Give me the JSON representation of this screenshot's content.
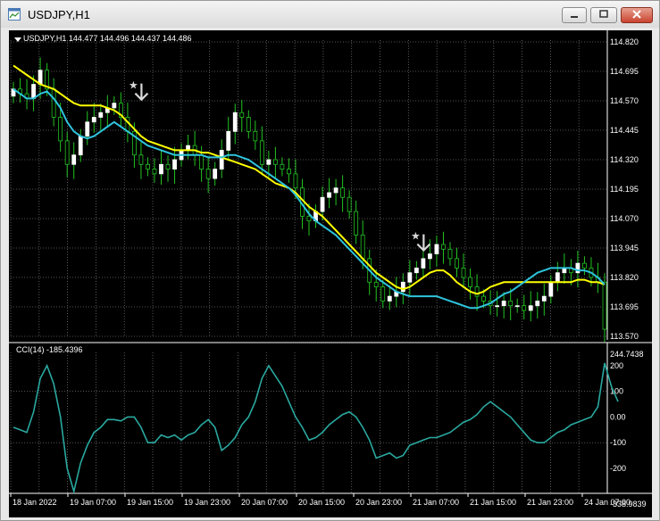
{
  "window": {
    "title": "USDJPY,H1",
    "icon": "chart-window-icon"
  },
  "chart": {
    "symbol_line": "USDJPY,H1  144.477 144.496 144.437 144.486",
    "cci_line": "CCI(14) -185.4396",
    "background": "#000000",
    "grid_color": "#6e6e6e",
    "bull_color": "#ffffff",
    "bear_color": "#000000",
    "wick_color": "#22c422",
    "ma_fast_color": "#2ec4dc",
    "ma_slow_color": "#ffff00",
    "cci_color": "#2aa9a0",
    "text_color": "#ffffff"
  },
  "chart_data": [
    {
      "type": "candlestick",
      "title": "USDJPY,H1",
      "ylim": [
        113.57,
        114.82
      ],
      "price_ticks": [
        "114.820",
        "114.695",
        "114.570",
        "114.445",
        "114.320",
        "114.195",
        "114.070",
        "113.945",
        "113.820",
        "113.695",
        "113.570"
      ],
      "time_labels": [
        "18 Jan 2022",
        "19 Jan 07:00",
        "19 Jan 15:00",
        "19 Jan 23:00",
        "20 Jan 07:00",
        "20 Jan 15:00",
        "20 Jan 23:00",
        "21 Jan 07:00",
        "21 Jan 15:00",
        "21 Jan 23:00",
        "24 Jan 07:00"
      ],
      "close": [
        114.62,
        114.6,
        114.58,
        114.64,
        114.7,
        114.62,
        114.5,
        114.4,
        114.3,
        114.34,
        114.42,
        114.48,
        114.5,
        114.52,
        114.54,
        114.56,
        114.5,
        114.44,
        114.34,
        114.3,
        114.28,
        114.26,
        114.3,
        114.28,
        114.32,
        114.36,
        114.38,
        114.34,
        114.28,
        114.24,
        114.28,
        114.36,
        114.44,
        114.52,
        114.5,
        114.44,
        114.4,
        114.3,
        114.32,
        114.3,
        114.28,
        114.26,
        114.2,
        114.08,
        114.06,
        114.1,
        114.16,
        114.18,
        114.2,
        114.16,
        114.1,
        114.0,
        113.9,
        113.8,
        113.78,
        113.72,
        113.74,
        113.76,
        113.8,
        113.84,
        113.86,
        113.9,
        113.92,
        113.96,
        113.94,
        113.9,
        113.86,
        113.82,
        113.78,
        113.74,
        113.72,
        113.7,
        113.7,
        113.72,
        113.7,
        113.7,
        113.68,
        113.7,
        113.72,
        113.74,
        113.8,
        113.84,
        113.86,
        113.84,
        113.88,
        113.86,
        113.82,
        113.8,
        113.6
      ],
      "ma_slow": [
        114.72,
        114.7,
        114.68,
        114.66,
        114.64,
        114.63,
        114.62,
        114.6,
        114.58,
        114.56,
        114.55,
        114.55,
        114.55,
        114.55,
        114.54,
        114.53,
        114.51,
        114.48,
        114.45,
        114.42,
        114.4,
        114.39,
        114.38,
        114.37,
        114.36,
        114.36,
        114.36,
        114.36,
        114.35,
        114.35,
        114.34,
        114.33,
        114.32,
        114.31,
        114.3,
        114.29,
        114.28,
        114.26,
        114.24,
        114.22,
        114.21,
        114.2,
        114.18,
        114.15,
        114.12,
        114.1,
        114.08,
        114.05,
        114.02,
        113.99,
        113.96,
        113.93,
        113.9,
        113.87,
        113.84,
        113.82,
        113.8,
        113.78,
        113.77,
        113.78,
        113.8,
        113.82,
        113.84,
        113.85,
        113.85,
        113.83,
        113.8,
        113.78,
        113.76,
        113.75,
        113.76,
        113.78,
        113.79,
        113.8,
        113.8,
        113.8,
        113.8,
        113.8,
        113.8,
        113.8,
        113.8,
        113.8,
        113.8,
        113.8,
        113.81,
        113.81,
        113.8,
        113.8,
        113.79
      ],
      "ma_fast": [
        114.62,
        114.6,
        114.58,
        114.58,
        114.6,
        114.61,
        114.58,
        114.54,
        114.48,
        114.44,
        114.42,
        114.41,
        114.42,
        114.44,
        114.46,
        114.48,
        114.46,
        114.44,
        114.42,
        114.4,
        114.38,
        114.37,
        114.36,
        114.35,
        114.34,
        114.34,
        114.34,
        114.34,
        114.34,
        114.33,
        114.33,
        114.33,
        114.34,
        114.34,
        114.33,
        114.32,
        114.3,
        114.28,
        114.26,
        114.24,
        114.22,
        114.2,
        114.17,
        114.13,
        114.09,
        114.06,
        114.04,
        114.02,
        114.0,
        113.97,
        113.94,
        113.91,
        113.88,
        113.85,
        113.82,
        113.8,
        113.78,
        113.76,
        113.75,
        113.74,
        113.74,
        113.74,
        113.74,
        113.74,
        113.73,
        113.72,
        113.71,
        113.7,
        113.69,
        113.69,
        113.7,
        113.71,
        113.73,
        113.75,
        113.76,
        113.78,
        113.8,
        113.82,
        113.84,
        113.85,
        113.86,
        113.86,
        113.86,
        113.86,
        113.85,
        113.85,
        113.84,
        113.82,
        113.79
      ],
      "arrows": [
        {
          "index": 18,
          "price": 114.56
        },
        {
          "index": 60,
          "price": 113.92
        }
      ]
    },
    {
      "type": "line",
      "title": "CCI(14)",
      "ylim": [
        -338.9839,
        244.7438
      ],
      "ticks": [
        "244.7438",
        "200",
        "100",
        "0.00",
        "-100",
        "-200",
        "-338.9839"
      ],
      "values": [
        -40,
        -50,
        -60,
        20,
        150,
        200,
        130,
        0,
        -200,
        -290,
        -180,
        -110,
        -60,
        -40,
        -10,
        -10,
        -15,
        0,
        0,
        -40,
        -100,
        -100,
        -70,
        -80,
        -70,
        -90,
        -70,
        -60,
        -30,
        -10,
        -40,
        -130,
        -110,
        -80,
        -30,
        0,
        60,
        150,
        200,
        160,
        120,
        60,
        0,
        -40,
        -90,
        -80,
        -60,
        -30,
        -10,
        10,
        20,
        0,
        -40,
        -90,
        -160,
        -150,
        -140,
        -160,
        -150,
        -110,
        -100,
        -90,
        -80,
        -80,
        -70,
        -60,
        -40,
        -20,
        -10,
        10,
        40,
        60,
        40,
        20,
        0,
        -30,
        -60,
        -90,
        -100,
        -100,
        -80,
        -60,
        -50,
        -30,
        -20,
        -10,
        0,
        40,
        210,
        120,
        60
      ]
    }
  ]
}
